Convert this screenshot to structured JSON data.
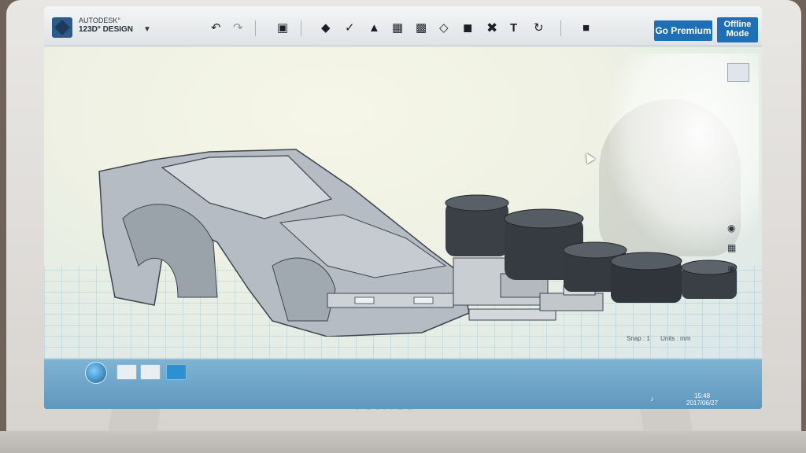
{
  "app": {
    "logo_line1": "AUTODESK°",
    "logo_line2": "123D° DESIGN"
  },
  "toolbar": {
    "undo_icon": "↶",
    "redo_icon": "↷",
    "icons": [
      "import-icon",
      "primitives-icon",
      "sketch-icon",
      "construct-icon",
      "modify-icon",
      "pattern-icon",
      "grouping-icon",
      "combine-icon",
      "measure-icon",
      "text-icon",
      "snap-icon",
      "material-icon"
    ],
    "go_premium": "Go Premium",
    "offline_mode": "Offline Mode",
    "help": "?"
  },
  "viewport": {
    "snap": "Snap : 1",
    "units": "Units : mm"
  },
  "taskbar": {
    "time": "15:48",
    "date": "2017/06/27"
  },
  "device": {
    "brand": "FUJITSU"
  }
}
